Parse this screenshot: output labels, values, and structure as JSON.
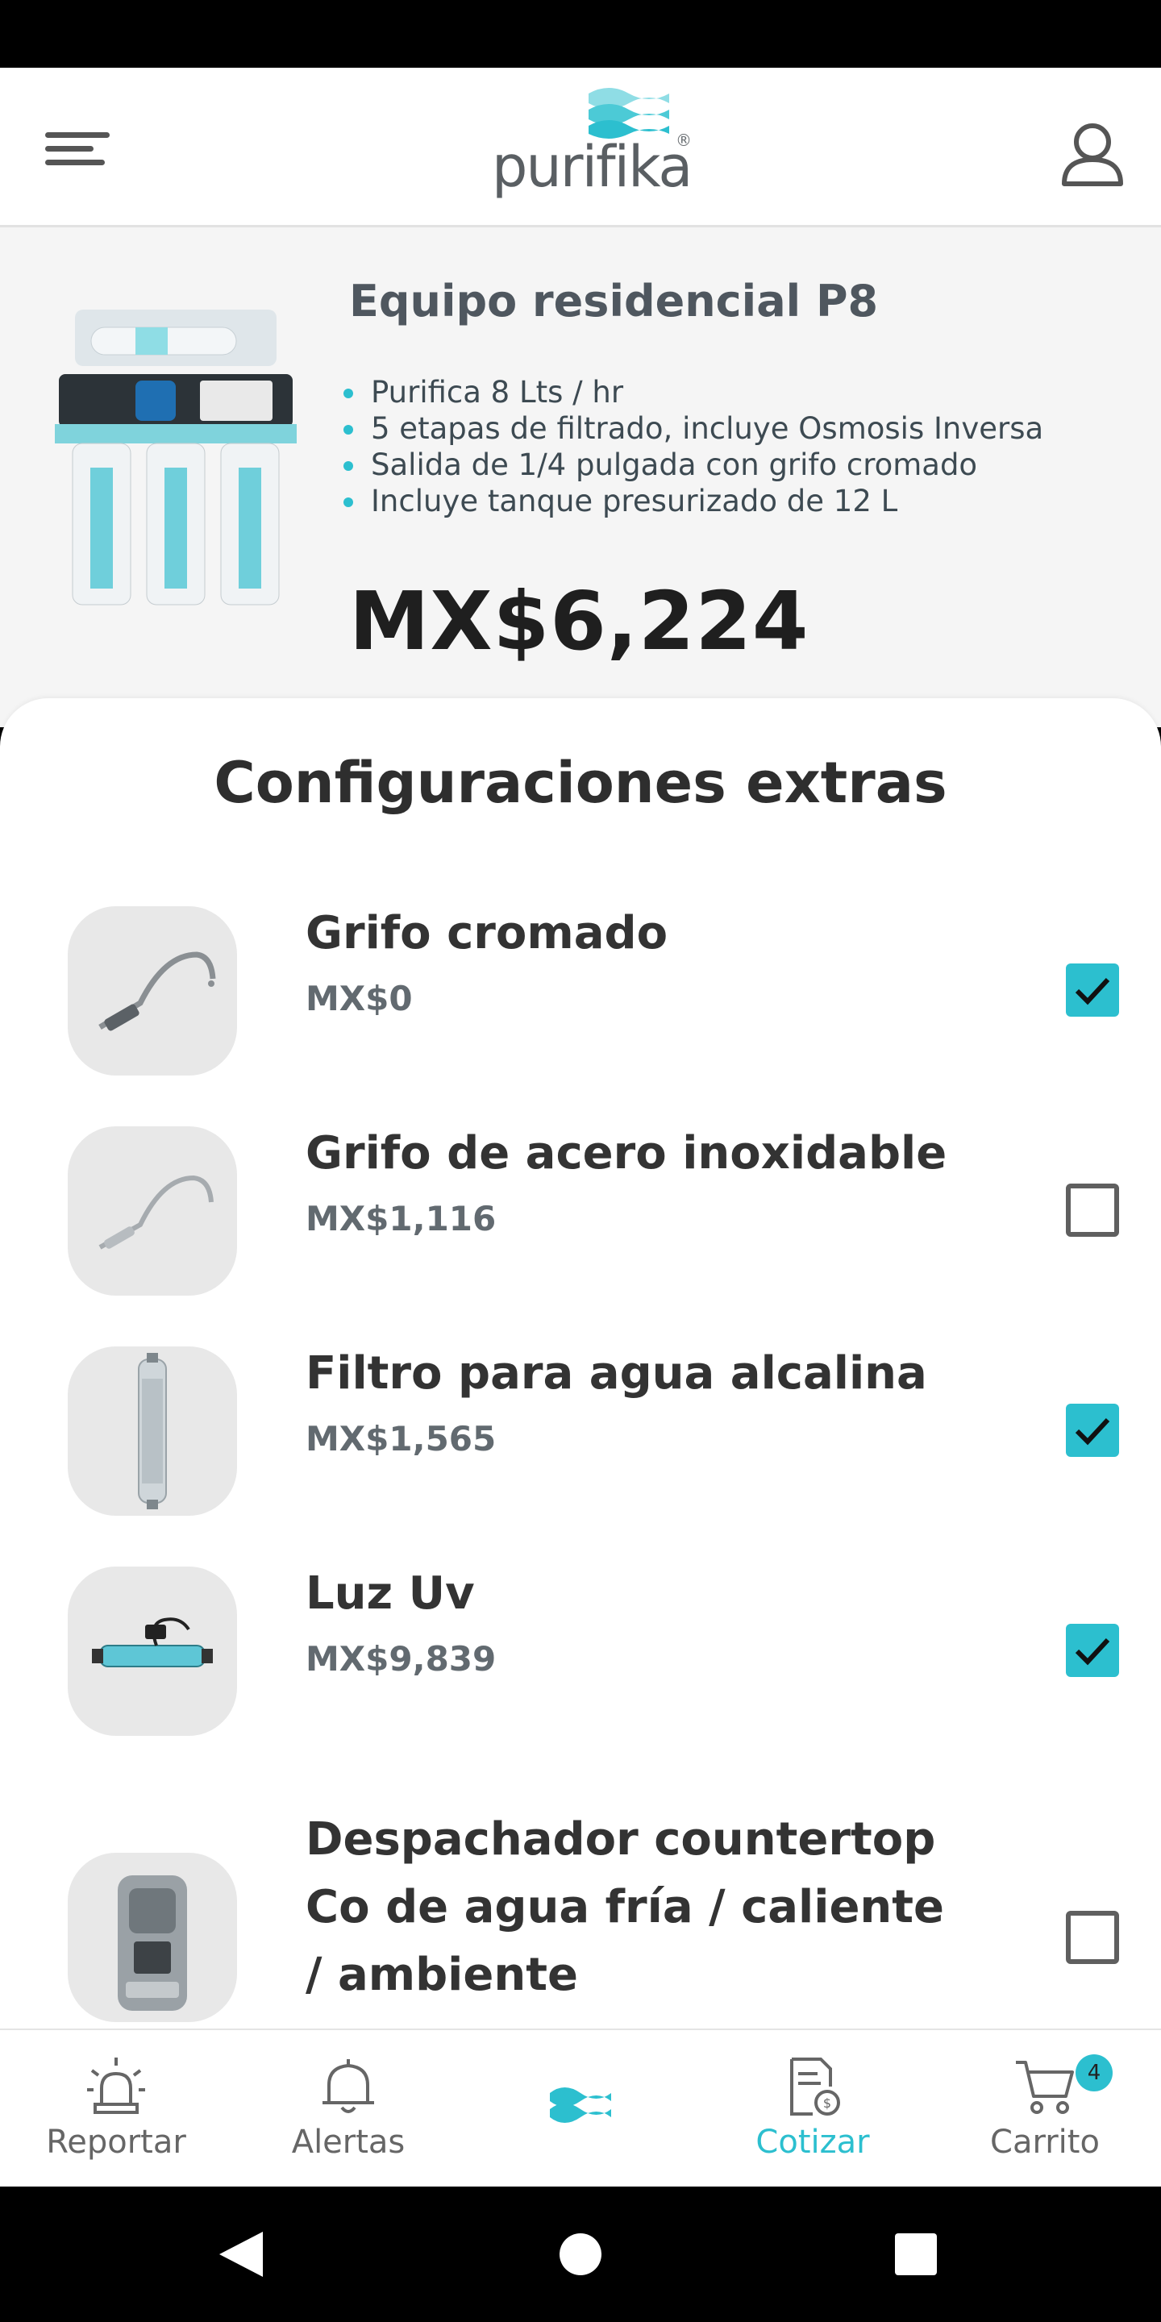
{
  "header": {
    "logo_text": "purifika",
    "logo_mark": "®",
    "menu_icon": "menu-icon",
    "profile_icon": "user-icon"
  },
  "product": {
    "title": "Equipo residencial P8",
    "features": [
      "Purifica 8 Lts / hr",
      "5 etapas de filtrado, incluye Osmosis Inversa",
      "Salida de 1/4 pulgada con grifo cromado",
      "Incluye tanque presurizado de 12 L"
    ],
    "price": "MX$6,224"
  },
  "extras": {
    "title": "Configuraciones extras",
    "options": [
      {
        "name": "Grifo cromado",
        "price": "MX$0",
        "checked": true
      },
      {
        "name": "Grifo de acero inoxidable",
        "price": "MX$1,116",
        "checked": false
      },
      {
        "name": "Filtro para agua alcalina",
        "price": "MX$1,565",
        "checked": true
      },
      {
        "name": "Luz Uv",
        "price": "MX$9,839",
        "checked": true
      },
      {
        "name": "Despachador countertop Co de agua fría / caliente / ambiente",
        "price": "",
        "checked": false
      }
    ]
  },
  "bottom_nav": {
    "items": [
      {
        "label": "Reportar",
        "icon": "alarm-light-icon"
      },
      {
        "label": "Alertas",
        "icon": "bell-icon"
      },
      {
        "label": "",
        "icon": "waves-logo-icon"
      },
      {
        "label": "Cotizar",
        "icon": "quote-document-icon"
      },
      {
        "label": "Carrito",
        "icon": "cart-icon",
        "badge": "4"
      }
    ],
    "active": "Cotizar"
  },
  "colors": {
    "accent": "#2cbfcf",
    "title_text": "#4f575f",
    "price_text": "#1f1f1f"
  }
}
